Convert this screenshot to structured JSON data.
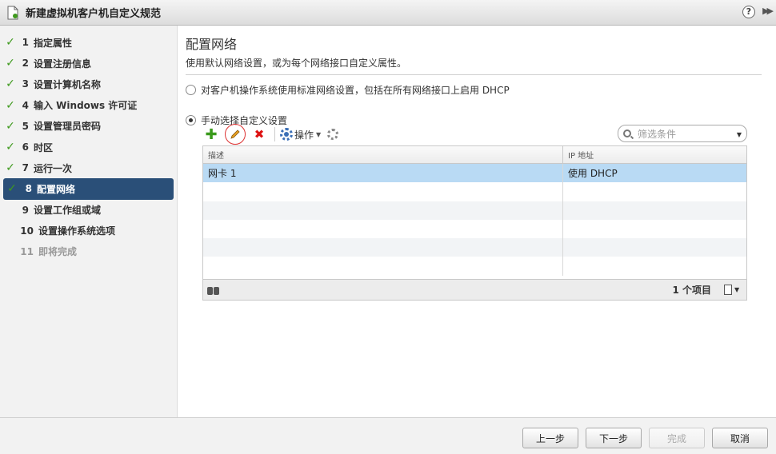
{
  "window": {
    "title": "新建虚拟机客户机自定义规范",
    "help_label": "?",
    "expand_label": "▶▶"
  },
  "steps": [
    {
      "num": "1",
      "label": "指定属性"
    },
    {
      "num": "2",
      "label": "设置注册信息"
    },
    {
      "num": "3",
      "label": "设置计算机名称"
    },
    {
      "num": "4",
      "label": "输入 Windows 许可证"
    },
    {
      "num": "5",
      "label": "设置管理员密码"
    },
    {
      "num": "6",
      "label": "时区"
    },
    {
      "num": "7",
      "label": "运行一次"
    },
    {
      "num": "8",
      "label": "配置网络"
    },
    {
      "num": "9",
      "label": "设置工作组或域"
    },
    {
      "num": "10",
      "label": "设置操作系统选项"
    },
    {
      "num": "11",
      "label": "即将完成"
    }
  ],
  "page": {
    "title": "配置网络",
    "subtitle": "使用默认网络设置，或为每个网络接口自定义属性。",
    "option_standard": "对客户机操作系统使用标准网络设置，包括在所有网络接口上启用 DHCP",
    "option_custom": "手动选择自定义设置"
  },
  "toolbar": {
    "actions_label": "操作",
    "filter_placeholder": "筛选条件"
  },
  "grid": {
    "columns": [
      "描述",
      "IP 地址"
    ],
    "rows": [
      {
        "desc": "网卡 1",
        "ip": "使用 DHCP"
      }
    ],
    "count_label": "1 个项目"
  },
  "footer": {
    "back": "上一步",
    "next": "下一步",
    "finish": "完成",
    "cancel": "取消"
  },
  "colors": {
    "active_step": "#2a4f78",
    "check": "#3f9a1e",
    "selected_row": "#b9daf4"
  }
}
